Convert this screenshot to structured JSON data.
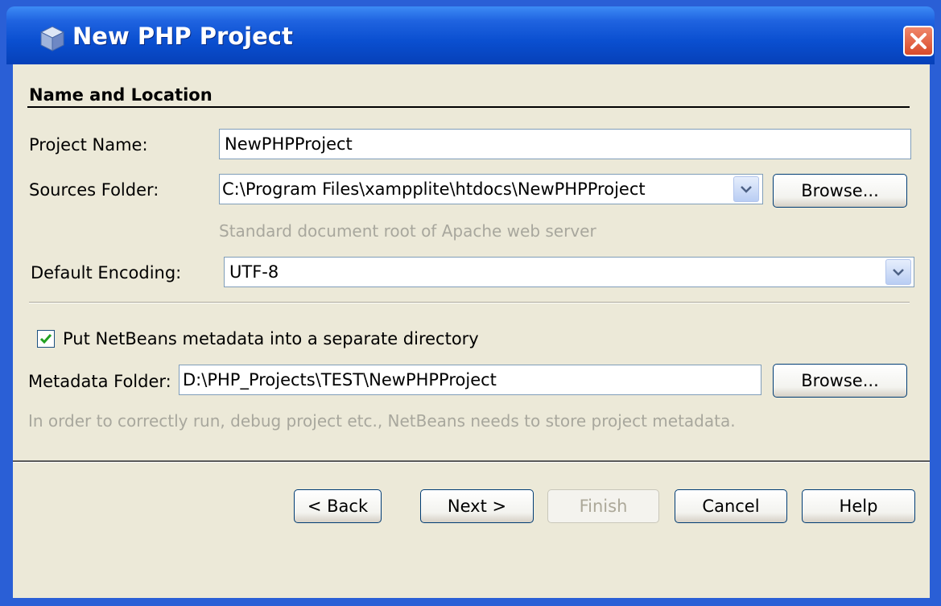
{
  "window": {
    "title": "New PHP Project"
  },
  "section": {
    "heading": "Name and Location"
  },
  "project_name": {
    "label": "Project Name:",
    "value": "NewPHPProject"
  },
  "sources_folder": {
    "label": "Sources Folder:",
    "value": "C:\\Program Files\\xampplite\\htdocs\\NewPHPProject",
    "browse_label": "Browse...",
    "hint": "Standard document root of Apache web server"
  },
  "encoding": {
    "label": "Default Encoding:",
    "value": "UTF-8"
  },
  "metadata": {
    "checkbox_label": "Put NetBeans metadata into a separate directory",
    "checked": true,
    "folder_label": "Metadata Folder:",
    "folder_value": "D:\\PHP_Projects\\TEST\\NewPHPProject",
    "browse_label": "Browse...",
    "hint": "In order to correctly run, debug project etc., NetBeans needs to store project metadata."
  },
  "buttons": {
    "back": "< Back",
    "next": "Next >",
    "finish": "Finish",
    "cancel": "Cancel",
    "help": "Help"
  },
  "colors": {
    "titlebar": "#0a4fd0",
    "dialog_bg": "#ece9d8",
    "hint_text": "#a8a79d",
    "check": "#21a121"
  }
}
